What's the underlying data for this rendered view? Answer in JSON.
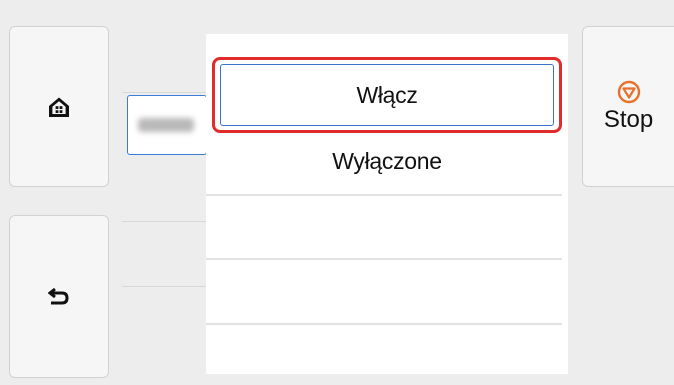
{
  "menu": {
    "options": [
      {
        "label": "Włącz",
        "selected": true
      },
      {
        "label": "Wyłączone",
        "selected": false
      }
    ]
  },
  "stop": {
    "label": "Stop",
    "icon": "stop-icon",
    "icon_color": "#e8702a"
  },
  "nav": {
    "home_icon": "home-icon",
    "back_icon": "back-icon"
  },
  "colors": {
    "highlight": "#e22b2b",
    "selection_border": "#3a72d0"
  }
}
